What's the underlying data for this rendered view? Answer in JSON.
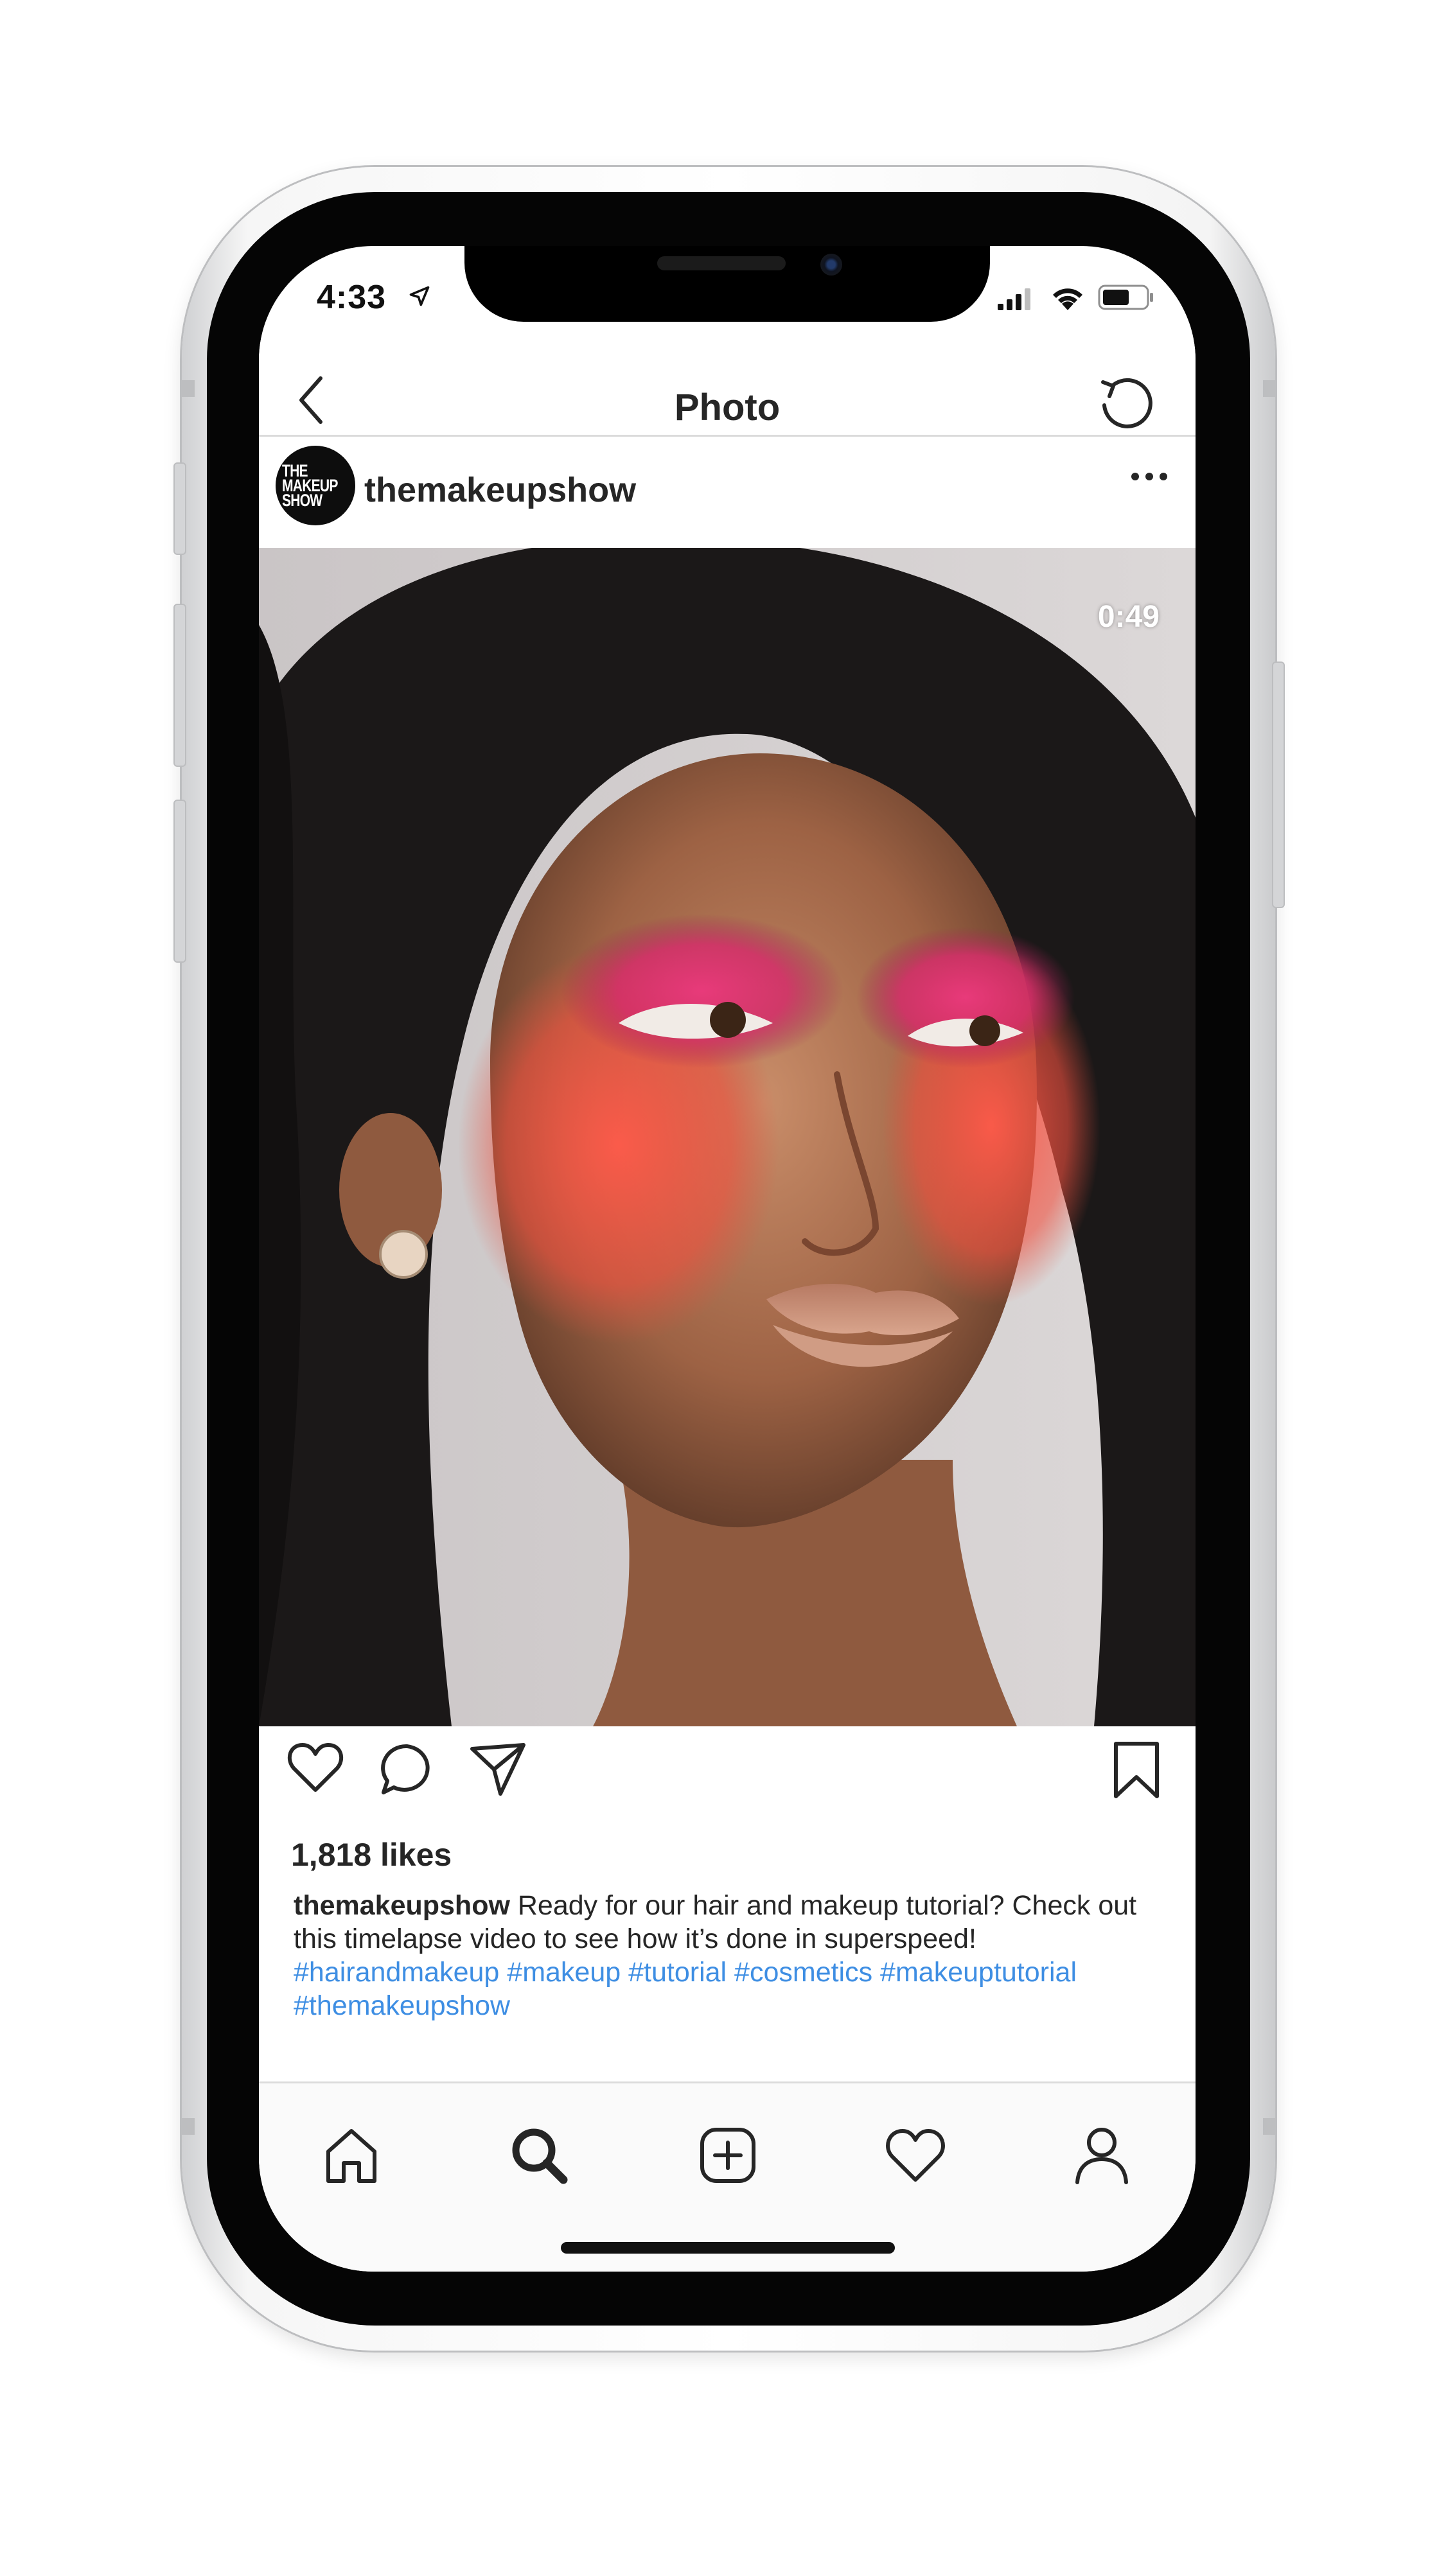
{
  "status_bar": {
    "time": "4:33",
    "icons": [
      "location-arrow-icon",
      "cellular-signal-icon",
      "wifi-icon",
      "battery-icon"
    ]
  },
  "header": {
    "title": "Photo",
    "back_icon": "chevron-left-icon",
    "refresh_icon": "refresh-icon"
  },
  "post": {
    "avatar_text": "THE MAKEUP SHOW",
    "username": "themakeupshow",
    "more_icon": "more-icon",
    "video_duration": "0:49",
    "media_description": "makeup-model-video",
    "likes": "1,818 likes",
    "caption_user": "themakeupshow",
    "caption_text": " Ready for our hair and makeup tutorial? Check out this timelapse video to see how it’s done in superspeed!",
    "hashtags": "#hairandmakeup #makeup #tutorial #cosmetics #makeuptutorial #themakeupshow"
  },
  "actions": [
    "like-icon",
    "comment-icon",
    "share-icon",
    "bookmark-icon"
  ],
  "tab_bar": [
    "home-icon",
    "search-icon",
    "add-post-icon",
    "activity-icon",
    "profile-icon"
  ],
  "colors": {
    "hashtag": "#3e8ee3",
    "text": "#262626",
    "divider": "#dbdbdb"
  }
}
